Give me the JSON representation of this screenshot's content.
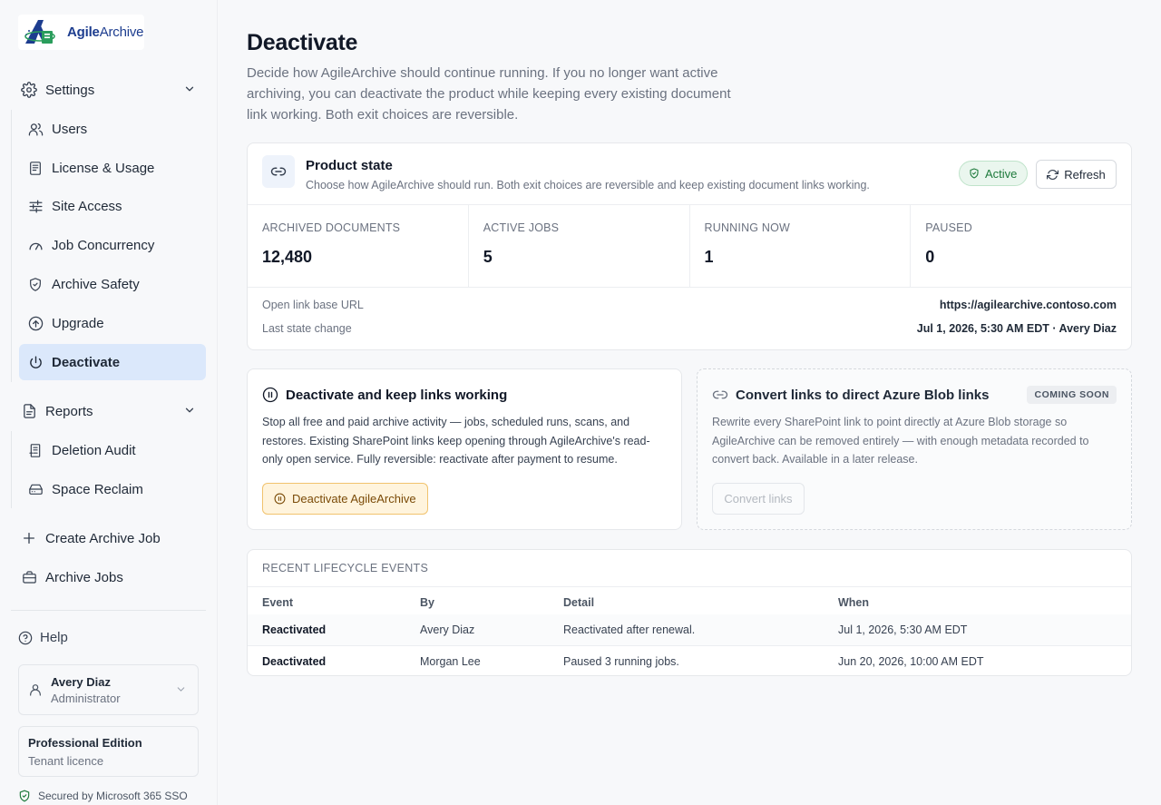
{
  "app": {
    "logo_alt": "AgileArchive",
    "logo_bold": "Agile",
    "logo_light": "Archive"
  },
  "sidebar": {
    "settings_label": "Settings",
    "settings_items": [
      {
        "label": "Users",
        "icon": "users-icon"
      },
      {
        "label": "License & Usage",
        "icon": "document-icon"
      },
      {
        "label": "Site Access",
        "icon": "sliders-icon"
      },
      {
        "label": "Job Concurrency",
        "icon": "gauge-icon"
      },
      {
        "label": "Archive Safety",
        "icon": "shield-icon"
      },
      {
        "label": "Upgrade",
        "icon": "arrow-up-circle-icon"
      },
      {
        "label": "Deactivate",
        "icon": "power-icon",
        "active": true
      }
    ],
    "reports_label": "Reports",
    "reports_items": [
      {
        "label": "Deletion Audit",
        "icon": "receipt-icon"
      },
      {
        "label": "Space Reclaim",
        "icon": "drive-icon"
      }
    ],
    "create_job": "Create Archive Job",
    "archive_jobs": "Archive Jobs",
    "help": "Help",
    "user": {
      "name": "Avery Diaz",
      "role": "Administrator"
    },
    "edition": {
      "title": "Professional Edition",
      "subtitle": "Tenant licence"
    },
    "secured": "Secured by Microsoft 365 SSO"
  },
  "main": {
    "title": "Deactivate",
    "description": "Decide how AgileArchive should continue running. If you no longer want active archiving, you can deactivate the product while keeping every existing document link working. Both exit choices are reversible.",
    "state": {
      "title": "Product state",
      "subtitle": "Choose how AgileArchive should run. Both exit choices are reversible and keep existing document links working.",
      "badge": "Active",
      "refresh": "Refresh",
      "stats": [
        {
          "label": "ARCHIVED DOCUMENTS",
          "value": "12,480"
        },
        {
          "label": "ACTIVE JOBS",
          "value": "5"
        },
        {
          "label": "RUNNING NOW",
          "value": "1"
        },
        {
          "label": "PAUSED",
          "value": "0"
        }
      ],
      "meta": [
        {
          "key": "Open link base URL",
          "value": "https://agilearchive.contoso.com"
        },
        {
          "key": "Last state change",
          "value": "Jul 1, 2026, 5:30 AM EDT · Avery Diaz"
        }
      ]
    },
    "option_deactivate": {
      "title": "Deactivate and keep links working",
      "body": "Stop all free and paid archive activity — jobs, scheduled runs, scans, and restores. Existing SharePoint links keep opening through AgileArchive's read-only open service. Fully reversible: reactivate after payment to resume.",
      "button": "Deactivate AgileArchive"
    },
    "option_convert": {
      "title": "Convert links to direct Azure Blob links",
      "badge": "COMING SOON",
      "body": "Rewrite every SharePoint link to point directly at Azure Blob storage so AgileArchive can be removed entirely — with enough metadata recorded to convert back. Available in a later release.",
      "button": "Convert links"
    },
    "events": {
      "heading": "RECENT LIFECYCLE EVENTS",
      "columns": [
        "Event",
        "By",
        "Detail",
        "When"
      ],
      "rows": [
        [
          "Reactivated",
          "Avery Diaz",
          "Reactivated after renewal.",
          "Jul 1, 2026, 5:30 AM EDT"
        ],
        [
          "Deactivated",
          "Morgan Lee",
          "Paused 3 running jobs.",
          "Jun 20, 2026, 10:00 AM EDT"
        ]
      ]
    }
  },
  "colors": {
    "accent": "#1d3d8f",
    "active_nav": "#dbe8fb",
    "success": "#1e7a3c",
    "warning_bg": "#fff4dd"
  }
}
